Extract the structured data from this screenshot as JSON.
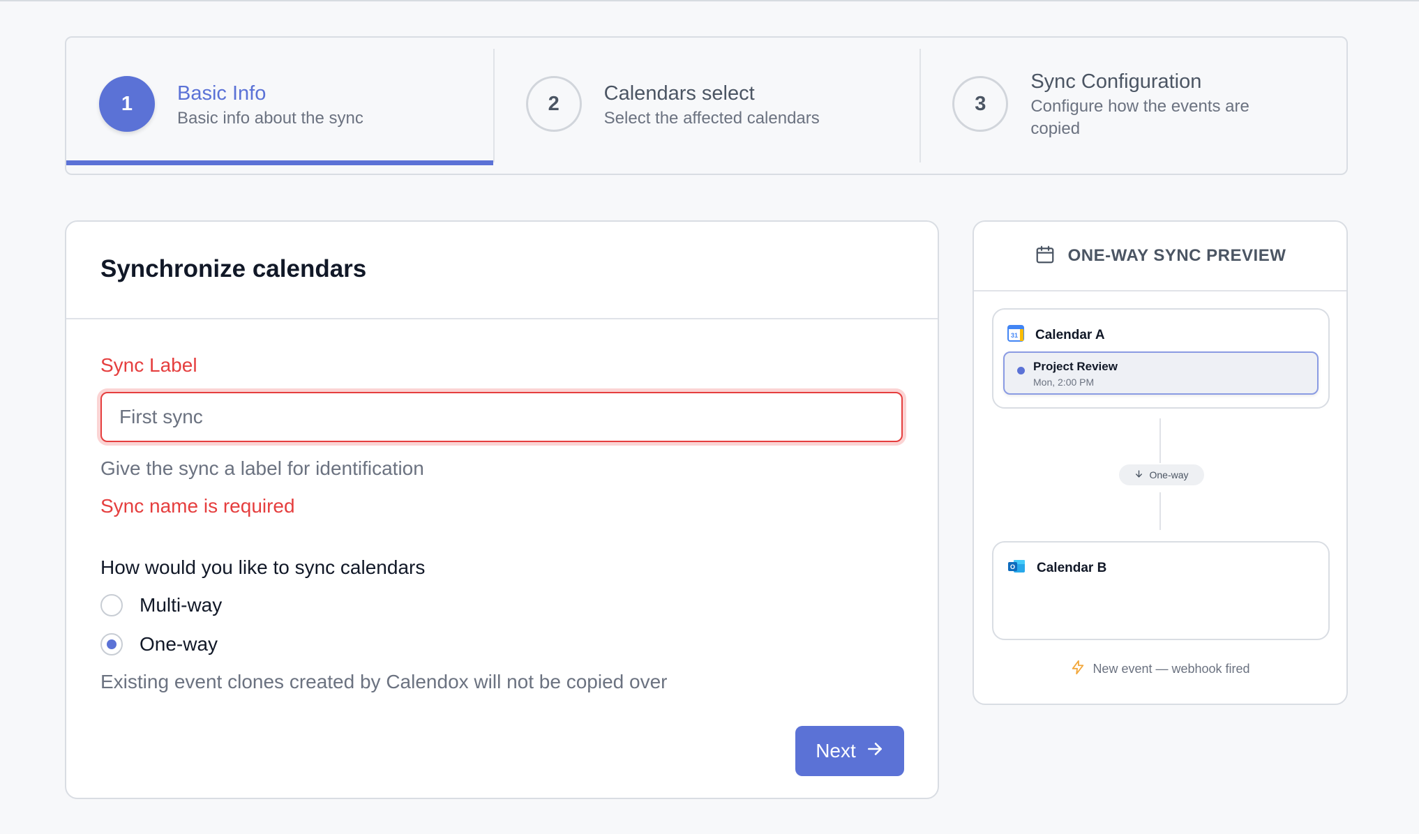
{
  "stepper": {
    "steps": [
      {
        "number": "1",
        "title": "Basic Info",
        "subtitle": "Basic info about the sync"
      },
      {
        "number": "2",
        "title": "Calendars select",
        "subtitle": "Select the affected calendars"
      },
      {
        "number": "3",
        "title": "Sync Configuration",
        "subtitle": "Configure how the events are copied"
      }
    ]
  },
  "form": {
    "title": "Synchronize calendars",
    "sync_label": {
      "label": "Sync Label",
      "value": "",
      "placeholder": "First sync",
      "helper": "Give the sync a label for identification",
      "error": "Sync name is required"
    },
    "mode_question": "How would you like to sync calendars",
    "options": [
      {
        "label": "Multi-way",
        "checked": false
      },
      {
        "label": "One-way",
        "checked": true
      }
    ],
    "note": "Existing event clones created by Calendox will not be copied over",
    "next_label": "Next"
  },
  "preview": {
    "title": "ONE-WAY SYNC PREVIEW",
    "calendar_a": {
      "name": "Calendar A",
      "icon": "google-calendar-icon"
    },
    "event": {
      "title": "Project Review",
      "time": "Mon, 2:00 PM"
    },
    "direction_label": "One-way",
    "calendar_b": {
      "name": "Calendar B",
      "icon": "outlook-icon"
    },
    "footer": "New event — webhook fired"
  },
  "colors": {
    "accent": "#5b72d6",
    "error": "#e53e3e",
    "muted": "#6b7280",
    "bolt": "#f2a73b"
  }
}
